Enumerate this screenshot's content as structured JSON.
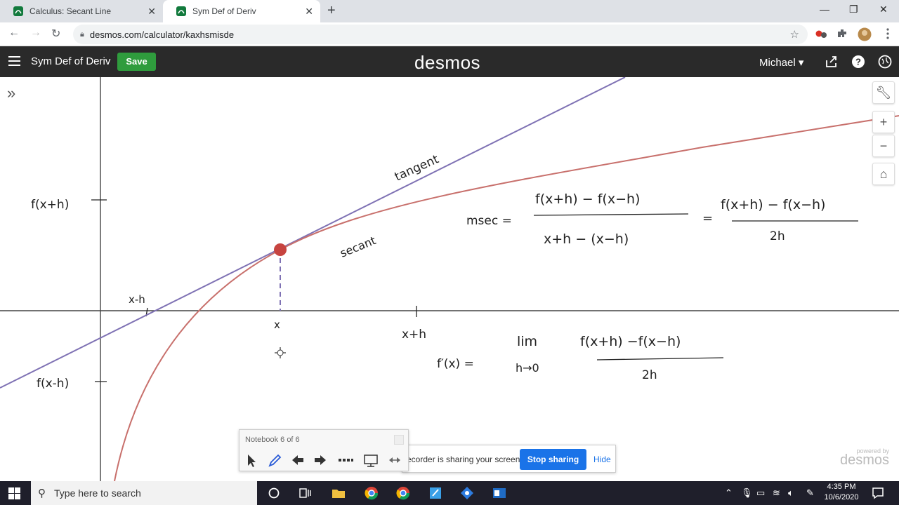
{
  "browser": {
    "tabs": [
      {
        "title": "Calculus: Secant Line",
        "active": false
      },
      {
        "title": "Sym Def of Deriv",
        "active": true
      }
    ],
    "url": "desmos.com/calculator/kaxhsmisde"
  },
  "desmos": {
    "graph_title": "Sym Def of Deriv",
    "save_label": "Save",
    "logo": "desmos",
    "user": "Michael",
    "powered_by": "powered by",
    "powered_logo": "desmos"
  },
  "annotations": {
    "f_x_plus_h": "f(x+h)",
    "f_x_minus_h": "f(x-h)",
    "x_minus_h": "x-h",
    "x": "x",
    "x_plus_h": "x+h",
    "tangent": "tangent",
    "secant": "secant",
    "msec_label": "msec =",
    "msec_num1": "f(x+h) − f(x−h)",
    "msec_den1": "x+h − (x−h)",
    "equals": "=",
    "msec_num2": "f(x+h) − f(x−h)",
    "msec_den2": "2h",
    "fprime_label": "f′(x) =",
    "lim": "lim",
    "lim_sub": "h→0",
    "limit_num": "f(x+h) −f(x−h)",
    "limit_den": "2h"
  },
  "notebook": {
    "title": "Notebook  6 of 6"
  },
  "share": {
    "message": "ecorder is sharing your screen.",
    "stop_label": "Stop sharing",
    "hide_label": "Hide"
  },
  "taskbar": {
    "search_placeholder": "Type here to search",
    "time": "4:35 PM",
    "date": "10/6/2020"
  },
  "colors": {
    "curve": "#c8706c",
    "tangent_line": "#7f72b4",
    "point": "#c74440",
    "save_green": "#2f9c3d"
  }
}
